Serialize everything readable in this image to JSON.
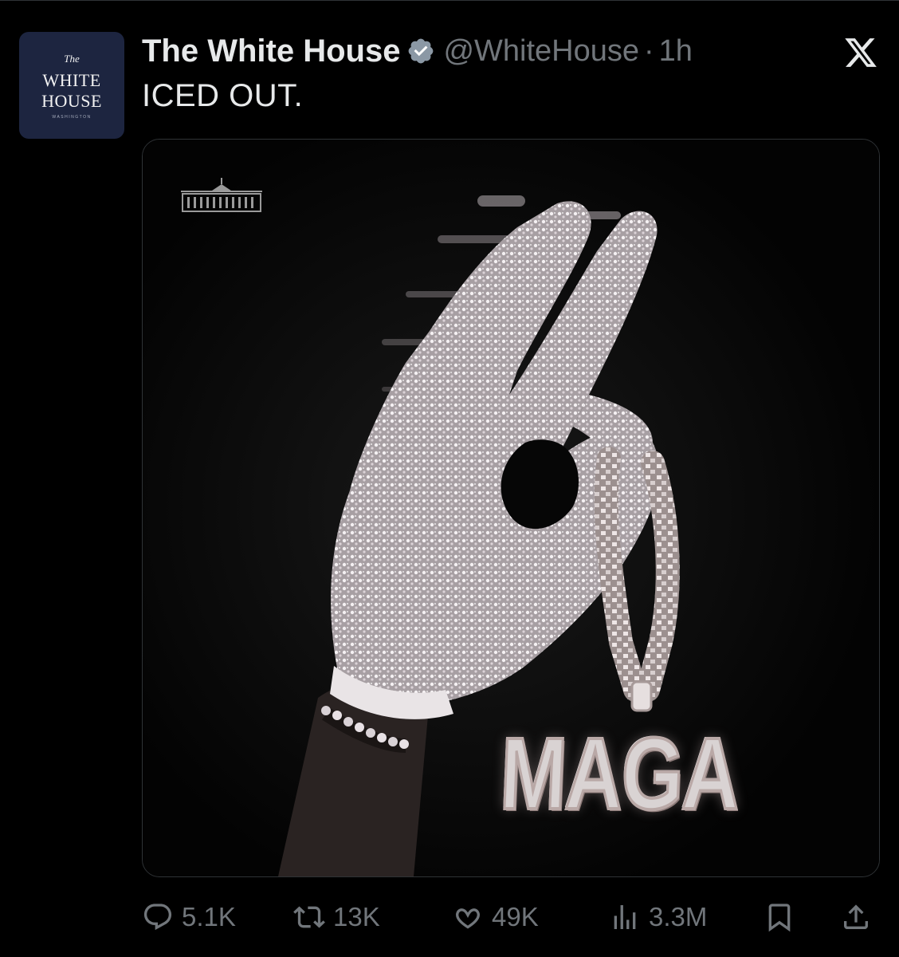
{
  "tweet": {
    "display_name": "The White House",
    "handle": "@WhiteHouse",
    "separator": "·",
    "timestamp": "1h",
    "text": "ICED OUT.",
    "verified": true
  },
  "avatar": {
    "line_the": "The",
    "line_1": "WHITE",
    "line_2": "HOUSE",
    "line_sub": "WASHINGTON",
    "background": "#1d2540"
  },
  "media": {
    "overlay_text": "MAGA"
  },
  "actions": {
    "replies": "5.1K",
    "reposts": "13K",
    "likes": "49K",
    "views": "3.3M"
  },
  "icons": {
    "platform": "x-logo-icon",
    "verified": "verified-badge-icon",
    "reply": "reply-icon",
    "repost": "repost-icon",
    "like": "heart-icon",
    "views": "views-icon",
    "bookmark": "bookmark-icon",
    "share": "share-icon"
  },
  "colors": {
    "background": "#000000",
    "text_primary": "#e7e9ea",
    "text_secondary": "#71767b",
    "border": "#2f3336"
  }
}
